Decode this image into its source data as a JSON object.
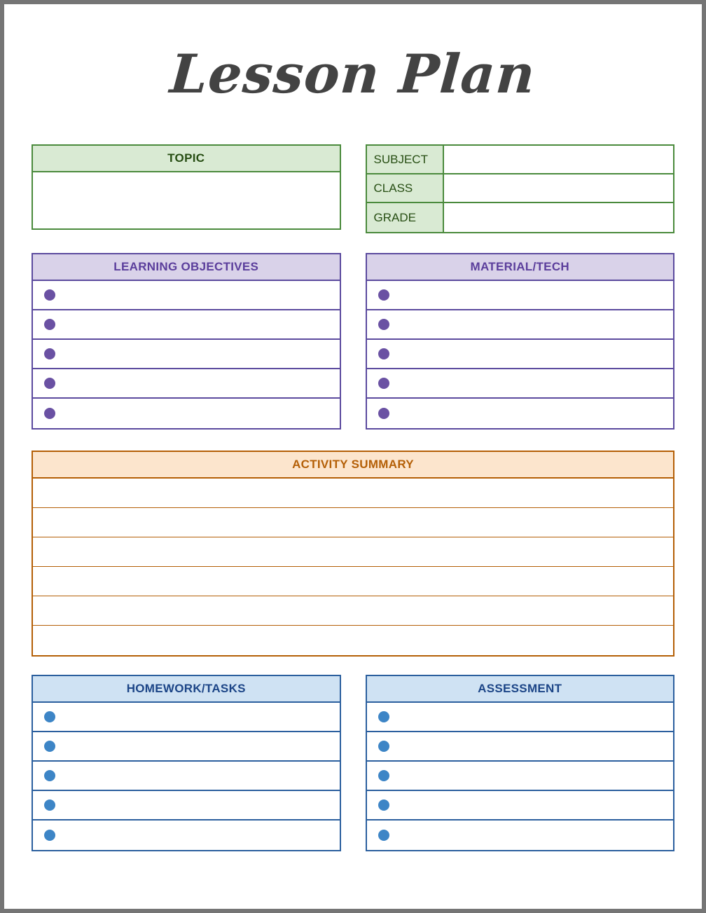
{
  "document": {
    "title": "Lesson Plan"
  },
  "colors": {
    "page_border": "#757575",
    "green_border": "#4a8a3c",
    "green_header_bg": "#d9ead3",
    "green_text": "#274e13",
    "purple_border": "#5b4a9e",
    "purple_header_bg": "#d9d2e9",
    "purple_text": "#5b3e9c",
    "purple_bullet": "#6a51a3",
    "orange_border": "#b45f06",
    "orange_header_bg": "#fce5cd",
    "orange_text": "#b45f06",
    "blue_border": "#2b5f9e",
    "blue_header_bg": "#cfe2f3",
    "blue_text": "#1c4587",
    "blue_bullet": "#3d85c6",
    "title_text": "#434343"
  },
  "topic": {
    "header": "TOPIC",
    "value": ""
  },
  "info": {
    "rows": [
      {
        "label": "SUBJECT",
        "value": ""
      },
      {
        "label": "CLASS",
        "value": ""
      },
      {
        "label": "GRADE",
        "value": ""
      }
    ]
  },
  "learning_objectives": {
    "header": "LEARNING OBJECTIVES",
    "bullet_icon": "filled-circle-icon",
    "items": [
      "",
      "",
      "",
      "",
      ""
    ]
  },
  "material_tech": {
    "header": "MATERIAL/TECH",
    "bullet_icon": "filled-circle-icon",
    "items": [
      "",
      "",
      "",
      "",
      ""
    ]
  },
  "activity_summary": {
    "header": "ACTIVITY SUMMARY",
    "lines": [
      "",
      "",
      "",
      "",
      "",
      ""
    ]
  },
  "homework_tasks": {
    "header": "HOMEWORK/TASKS",
    "bullet_icon": "filled-circle-icon",
    "items": [
      "",
      "",
      "",
      "",
      ""
    ]
  },
  "assessment": {
    "header": "ASSESSMENT",
    "bullet_icon": "filled-circle-icon",
    "items": [
      "",
      "",
      "",
      "",
      ""
    ]
  }
}
